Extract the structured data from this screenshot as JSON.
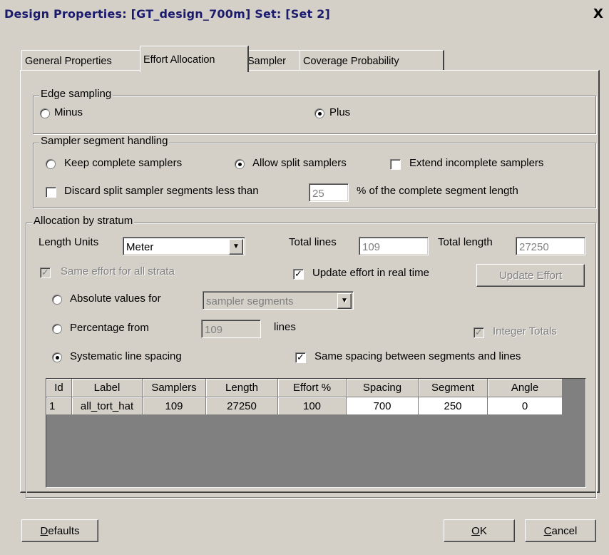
{
  "window": {
    "title": "Design Properties: [GT_design_700m] Set: [Set 2]",
    "close_glyph": "X"
  },
  "tabs": [
    {
      "label": "General Properties",
      "active": false
    },
    {
      "label": "Effort Allocation",
      "active": true
    },
    {
      "label": "Sampler",
      "active": false
    },
    {
      "label": "Coverage Probability",
      "active": false
    }
  ],
  "edge_sampling": {
    "legend": "Edge sampling",
    "minus_label": "Minus",
    "plus_label": "Plus",
    "selected": "Plus"
  },
  "segment_handling": {
    "legend": "Sampler segment handling",
    "keep_label": "Keep complete samplers",
    "allow_label": "Allow split samplers",
    "extend_label": "Extend incomplete samplers",
    "selected": "Allow split samplers",
    "extend_checked": false,
    "discard_label": "Discard split sampler segments less than",
    "discard_checked": false,
    "discard_value": "25",
    "discard_suffix": "% of the complete segment length"
  },
  "allocation": {
    "legend": "Allocation by stratum",
    "length_units_label": "Length Units",
    "length_units_value": "Meter",
    "total_lines_label": "Total lines",
    "total_lines_value": "109",
    "total_length_label": "Total length",
    "total_length_value": "27250",
    "same_effort_label": "Same effort for all strata",
    "same_effort_checked": true,
    "update_realtime_label": "Update effort in real time",
    "update_realtime_checked": true,
    "update_effort_button": "Update Effort",
    "absolute_label": "Absolute values for",
    "absolute_select_value": "sampler segments",
    "percentage_label": "Percentage from",
    "percentage_value": "109",
    "percentage_suffix": "lines",
    "integer_totals_label": "Integer Totals",
    "integer_totals_checked": true,
    "systematic_label": "Systematic line spacing",
    "selected_mode": "Systematic line spacing",
    "same_spacing_label": "Same spacing between segments and lines",
    "same_spacing_checked": true
  },
  "grid": {
    "columns": [
      "Id",
      "Label",
      "Samplers",
      "Length",
      "Effort %",
      "Spacing",
      "Segment",
      "Angle"
    ],
    "rows": [
      [
        "1",
        "all_tort_hat",
        "109",
        "27250",
        "100",
        "700",
        "250",
        "0"
      ]
    ]
  },
  "buttons": {
    "defaults_prefix": "D",
    "defaults_rest": "efaults",
    "ok_prefix": "O",
    "ok_rest": "K",
    "cancel_prefix": "C",
    "cancel_rest": "ancel"
  },
  "icons": {
    "combo_arrow": "triangle-down-icon",
    "check_mark": "checkmark-icon"
  }
}
